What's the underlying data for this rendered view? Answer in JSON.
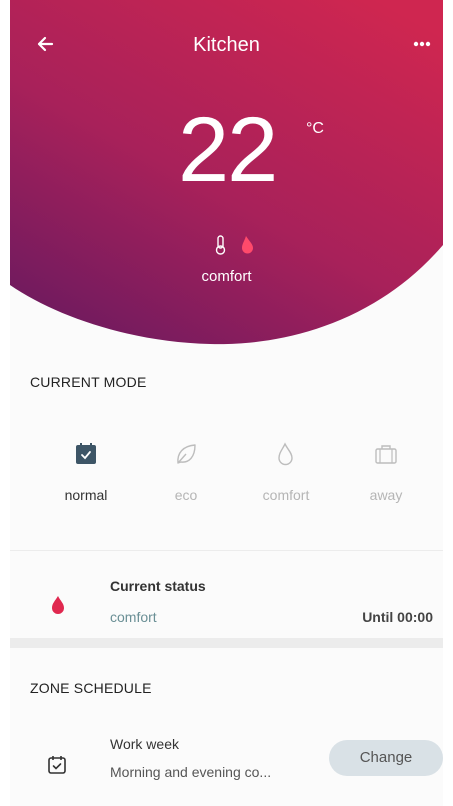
{
  "header": {
    "title": "Kitchen",
    "back_icon": "arrow-left-icon",
    "more_icon": "more-horizontal-icon",
    "gradient_top": "#c8254f",
    "gradient_bottom": "#7f1a5e"
  },
  "temperature": {
    "value": "22",
    "unit": "°C",
    "status_label": "comfort",
    "icons": [
      "thermometer-icon",
      "flame-icon"
    ]
  },
  "current_mode": {
    "title": "CURRENT MODE",
    "modes": [
      {
        "label": "normal",
        "icon": "calendar-icon",
        "active": true
      },
      {
        "label": "eco",
        "icon": "leaf-icon",
        "active": false
      },
      {
        "label": "comfort",
        "icon": "drop-icon",
        "active": false
      },
      {
        "label": "away",
        "icon": "suitcase-icon",
        "active": false
      }
    ]
  },
  "status": {
    "title": "Current status",
    "value": "comfort",
    "until": "Until 00:00",
    "icon": "flame-icon",
    "accent": "#e0284f"
  },
  "schedule": {
    "title": "ZONE SCHEDULE",
    "name": "Work week",
    "description": "Morning and evening co...",
    "button_label": "Change",
    "icon": "calendar-check-icon"
  }
}
